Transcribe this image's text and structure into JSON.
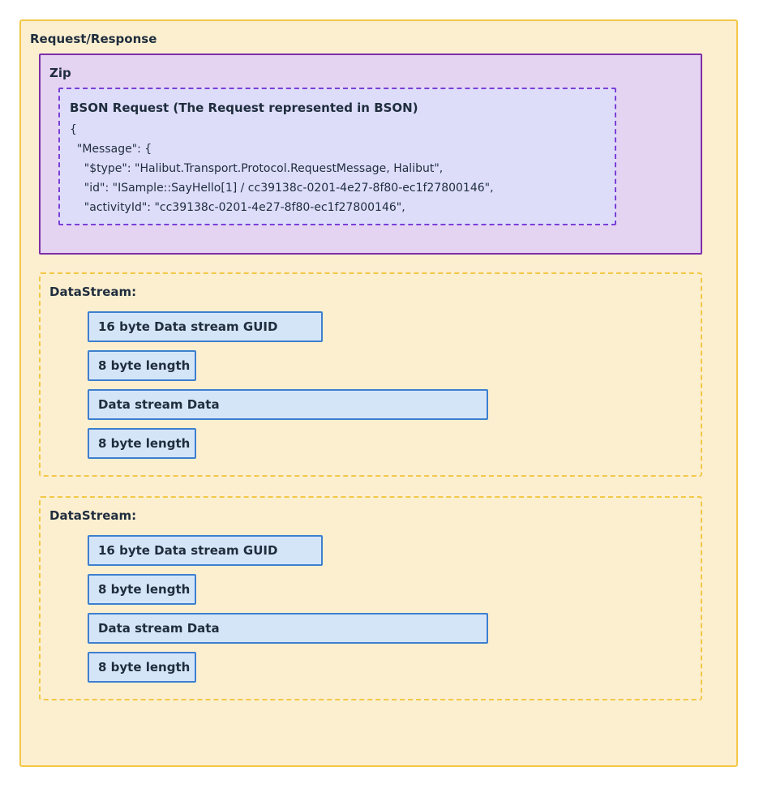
{
  "outer": {
    "title": "Request/Response"
  },
  "zip": {
    "title": "Zip",
    "bson": {
      "title": "BSON Request (The Request represented in BSON)",
      "code": "{\n  \"Message\": {\n    \"$type\": \"Halibut.Transport.Protocol.RequestMessage, Halibut\",\n    \"id\": \"ISample::SayHello[1] / cc39138c-0201-4e27-8f80-ec1f27800146\",\n    \"activityId\": \"cc39138c-0201-4e27-8f80-ec1f27800146\","
    }
  },
  "data_streams": [
    {
      "title": "DataStream:",
      "fields": {
        "guid": "16 byte Data stream GUID",
        "length_1": "8 byte length",
        "data": "Data stream Data",
        "length_2": "8 byte length"
      }
    },
    {
      "title": "DataStream:",
      "fields": {
        "guid": "16 byte Data stream GUID",
        "length_1": "8 byte length",
        "data": "Data stream Data",
        "length_2": "8 byte length"
      }
    }
  ],
  "colors": {
    "outer_fill": "#fcefd0",
    "outer_border": "#f3c847",
    "zip_fill": "#e5d3f2",
    "zip_border": "#7d2fa8",
    "bson_fill": "#ddddfa",
    "bson_border": "#7b3fd6",
    "field_fill": "#d5e5f8",
    "field_border": "#3d7fcf",
    "text": "#1f2d3d"
  }
}
